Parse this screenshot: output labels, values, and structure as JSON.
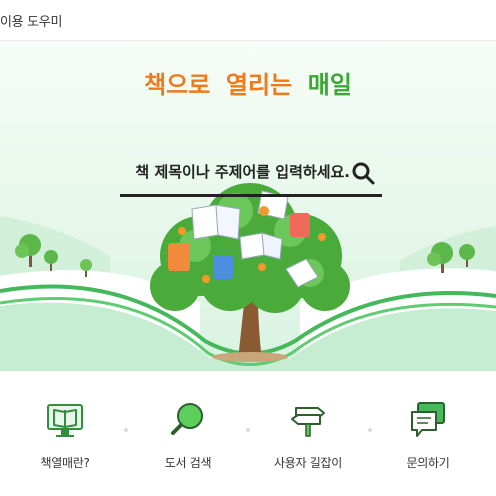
{
  "header": {
    "title": "이용 도우미"
  },
  "hero": {
    "slogan_part1": "책으로",
    "slogan_part2": "열리는",
    "slogan_part3": "매일",
    "colors": {
      "orange": "#f07a1a",
      "green": "#3aa832",
      "mint_bg": "#e6f7ec"
    }
  },
  "search": {
    "placeholder": "책 제목이나 주제어를 입력하세요."
  },
  "menu": {
    "items": [
      {
        "label": "책열매란?",
        "icon": "book-monitor-icon"
      },
      {
        "label": "도서 검색",
        "icon": "magnifier-icon"
      },
      {
        "label": "사용자 길잡이",
        "icon": "signpost-icon"
      },
      {
        "label": "문의하기",
        "icon": "speech-bubbles-icon"
      }
    ]
  }
}
